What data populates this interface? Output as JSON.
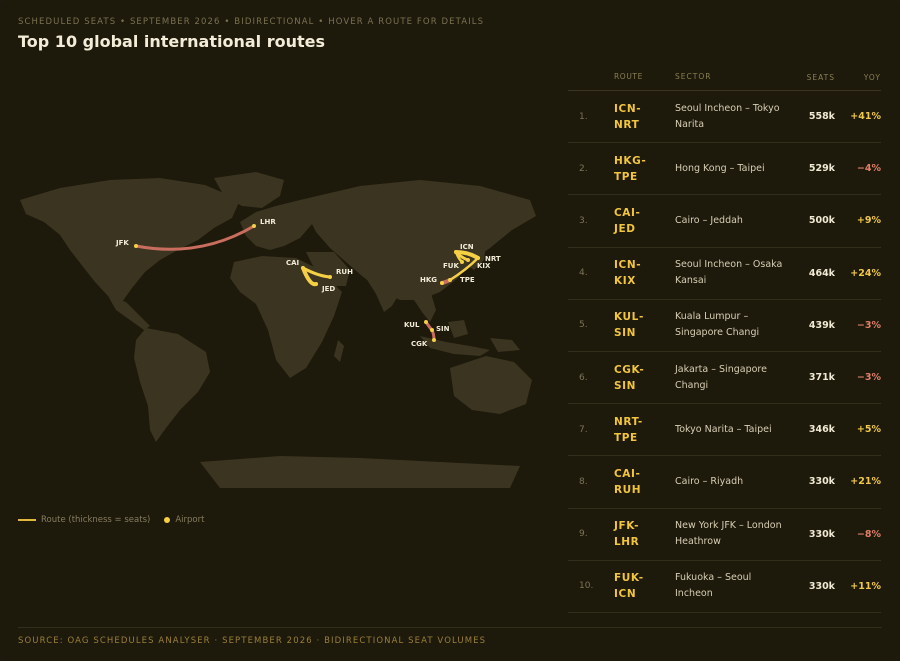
{
  "header": {
    "eyebrow": "SCHEDULED SEATS • SEPTEMBER 2026 • BIDIRECTIONAL • HOVER A ROUTE FOR DETAILS",
    "title": "Top 10 global international routes"
  },
  "map": {
    "airports": [
      "JFK",
      "LHR",
      "CAI",
      "RUH",
      "JED",
      "ICN",
      "NRT",
      "KIX",
      "FUK",
      "HKG",
      "TPE",
      "KUL",
      "SIN",
      "CGK"
    ]
  },
  "legend": {
    "route_label": "Route (thickness = seats)",
    "airport_label": "Airport"
  },
  "table": {
    "headers": {
      "route": "ROUTE",
      "sector": "SECTOR",
      "seats": "SEATS",
      "yoy": "YOY"
    },
    "rows": [
      {
        "rank": "1.",
        "route1": "ICN-",
        "route2": "NRT",
        "sector": "Seoul Incheon – Tokyo Narita",
        "seats": "558k",
        "yoy": "+41%",
        "dir": "pos"
      },
      {
        "rank": "2.",
        "route1": "HKG-",
        "route2": "TPE",
        "sector": "Hong Kong – Taipei",
        "seats": "529k",
        "yoy": "−4%",
        "dir": "neg"
      },
      {
        "rank": "3.",
        "route1": "CAI-",
        "route2": "JED",
        "sector": "Cairo – Jeddah",
        "seats": "500k",
        "yoy": "+9%",
        "dir": "pos"
      },
      {
        "rank": "4.",
        "route1": "ICN-",
        "route2": "KIX",
        "sector": "Seoul Incheon – Osaka Kansai",
        "seats": "464k",
        "yoy": "+24%",
        "dir": "pos"
      },
      {
        "rank": "5.",
        "route1": "KUL-",
        "route2": "SIN",
        "sector": "Kuala Lumpur – Singapore Changi",
        "seats": "439k",
        "yoy": "−3%",
        "dir": "neg"
      },
      {
        "rank": "6.",
        "route1": "CGK-",
        "route2": "SIN",
        "sector": "Jakarta – Singapore Changi",
        "seats": "371k",
        "yoy": "−3%",
        "dir": "neg"
      },
      {
        "rank": "7.",
        "route1": "NRT-",
        "route2": "TPE",
        "sector": "Tokyo Narita – Taipei",
        "seats": "346k",
        "yoy": "+5%",
        "dir": "pos"
      },
      {
        "rank": "8.",
        "route1": "CAI-",
        "route2": "RUH",
        "sector": "Cairo – Riyadh",
        "seats": "330k",
        "yoy": "+21%",
        "dir": "pos"
      },
      {
        "rank": "9.",
        "route1": "JFK-",
        "route2": "LHR",
        "sector": "New York JFK – London Heathrow",
        "seats": "330k",
        "yoy": "−8%",
        "dir": "neg"
      },
      {
        "rank": "10.",
        "route1": "FUK-",
        "route2": "ICN",
        "sector": "Fukuoka – Seoul Incheon",
        "seats": "330k",
        "yoy": "+11%",
        "dir": "pos"
      }
    ]
  },
  "footer": {
    "source": "SOURCE: OAG SCHEDULES ANALYSER · SEPTEMBER 2026 · BIDIRECTIONAL SEAT VOLUMES"
  },
  "colors": {
    "background": "#1d190b",
    "land": "#3b3420",
    "route_up": "#f5cf45",
    "route_down": "#c96d5e",
    "positive": "#f0c84a",
    "negative": "#e07f6a"
  }
}
